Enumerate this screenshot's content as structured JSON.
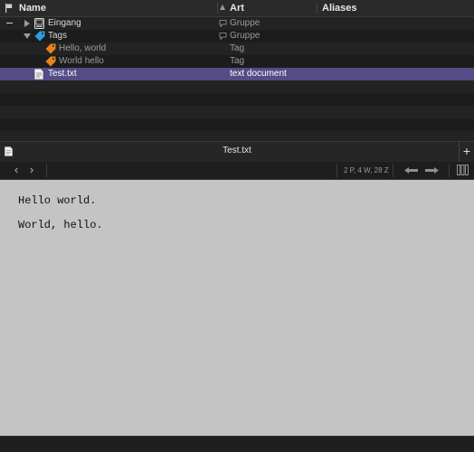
{
  "columns": {
    "name": "Name",
    "art": "Art",
    "aliases": "Aliases"
  },
  "rows": [
    {
      "name": "Eingang",
      "kind": "Gruppe",
      "icon": "inbox-icon"
    },
    {
      "name": "Tags",
      "kind": "Gruppe",
      "icon": "tag-icon"
    },
    {
      "name": "Hello, world",
      "kind": "Tag",
      "icon": "tag-icon"
    },
    {
      "name": "World hello",
      "kind": "Tag",
      "icon": "tag-icon"
    },
    {
      "name": "Test.txt",
      "kind": "text document",
      "icon": "text-file-icon"
    }
  ],
  "tab": {
    "title": "Test.txt",
    "add_label": "+"
  },
  "toolbar": {
    "back": "‹",
    "forward": "›",
    "stats": "2 P, 4 W, 28 Z"
  },
  "document": {
    "lines": [
      "Hello world.",
      "World, hello."
    ]
  },
  "colors": {
    "selection": "#544c86",
    "tag_outer": "#e8821e",
    "tag_blue": "#2f9ddc",
    "editor_bg": "#c4c4c4"
  }
}
